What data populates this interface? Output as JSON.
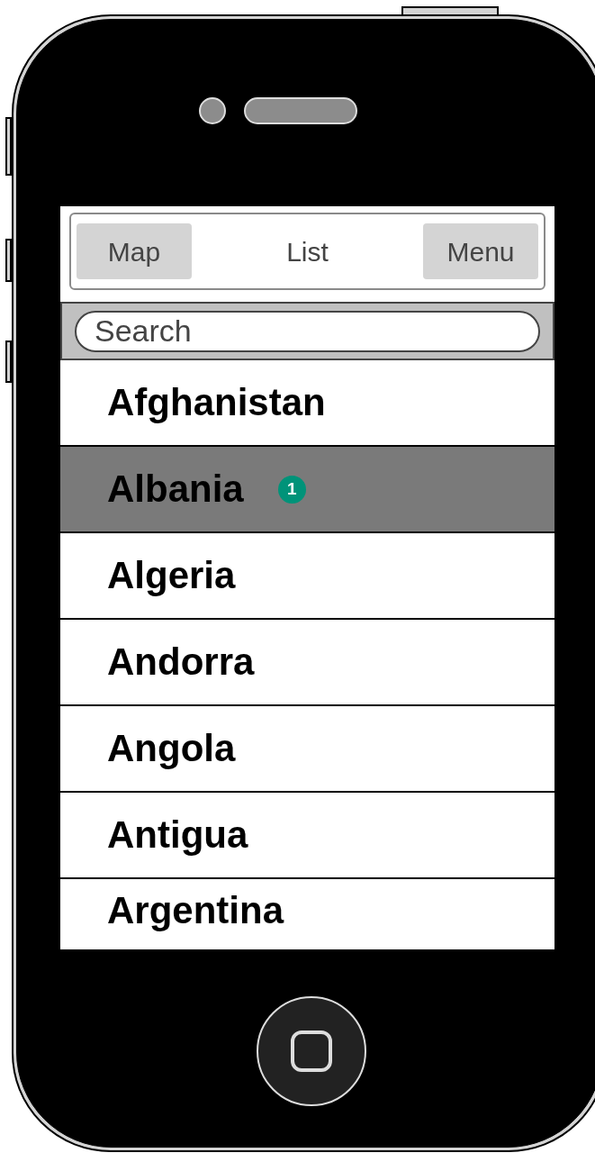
{
  "nav_bar": {
    "left_button": "Map",
    "title": "List",
    "right_button": "Menu"
  },
  "search": {
    "placeholder": "Search"
  },
  "countries": [
    {
      "name": "Afghanistan",
      "selected": false
    },
    {
      "name": "Albania",
      "selected": true,
      "badge": "1"
    },
    {
      "name": "Algeria",
      "selected": false
    },
    {
      "name": "Andorra",
      "selected": false
    },
    {
      "name": "Angola",
      "selected": false
    },
    {
      "name": "Antigua",
      "selected": false
    },
    {
      "name": "Argentina",
      "selected": false
    }
  ]
}
